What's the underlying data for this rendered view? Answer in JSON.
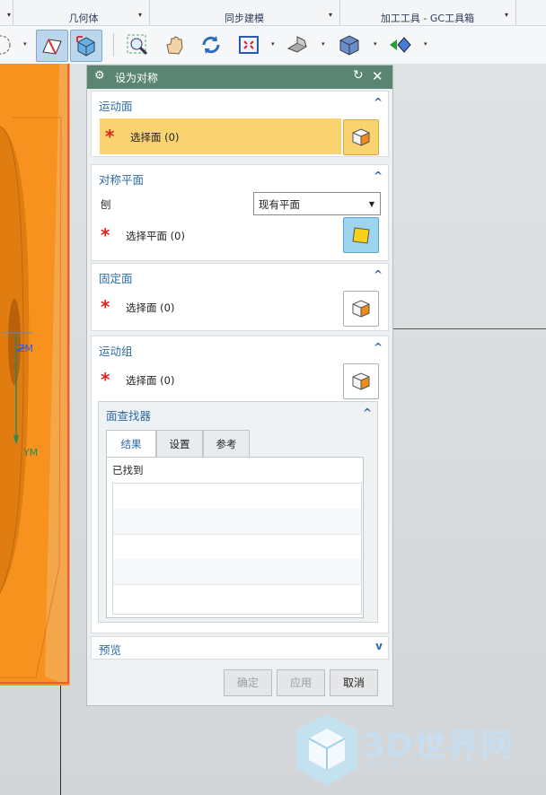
{
  "ribbon": {
    "groups": [
      {
        "label": "几何体"
      },
      {
        "label": "同步建模"
      },
      {
        "label": "加工工具 - GC工具箱"
      }
    ]
  },
  "dialog": {
    "title": "设为对称",
    "sections": {
      "motion_face": {
        "title": "运动面",
        "select_label": "选择面 (0)"
      },
      "sym_plane": {
        "title": "对称平面",
        "field_label": "刨",
        "combo_value": "现有平面",
        "select_label": "选择平面 (0)"
      },
      "fixed_face": {
        "title": "固定面",
        "select_label": "选择面 (0)"
      },
      "motion_group": {
        "title": "运动组",
        "select_label": "选择面 (0)"
      }
    },
    "face_finder": {
      "title": "面查找器",
      "tabs": [
        "结果",
        "设置",
        "参考"
      ],
      "found_label": "已找到"
    },
    "preview": {
      "title": "预览"
    },
    "buttons": {
      "ok": "确定",
      "apply": "应用",
      "cancel": "取消"
    }
  },
  "viewport": {
    "axis_labels": {
      "zm": "ZM",
      "ym": "YM"
    }
  },
  "watermark": {
    "brand": "3D世界网",
    "url": "WWW.3DSJW.COM"
  },
  "colors": {
    "accent_blue": "#2d6aa5",
    "title_bar": "#5b8573",
    "selection_highlight": "#f9d36f",
    "part_orange": "#f7921e"
  }
}
